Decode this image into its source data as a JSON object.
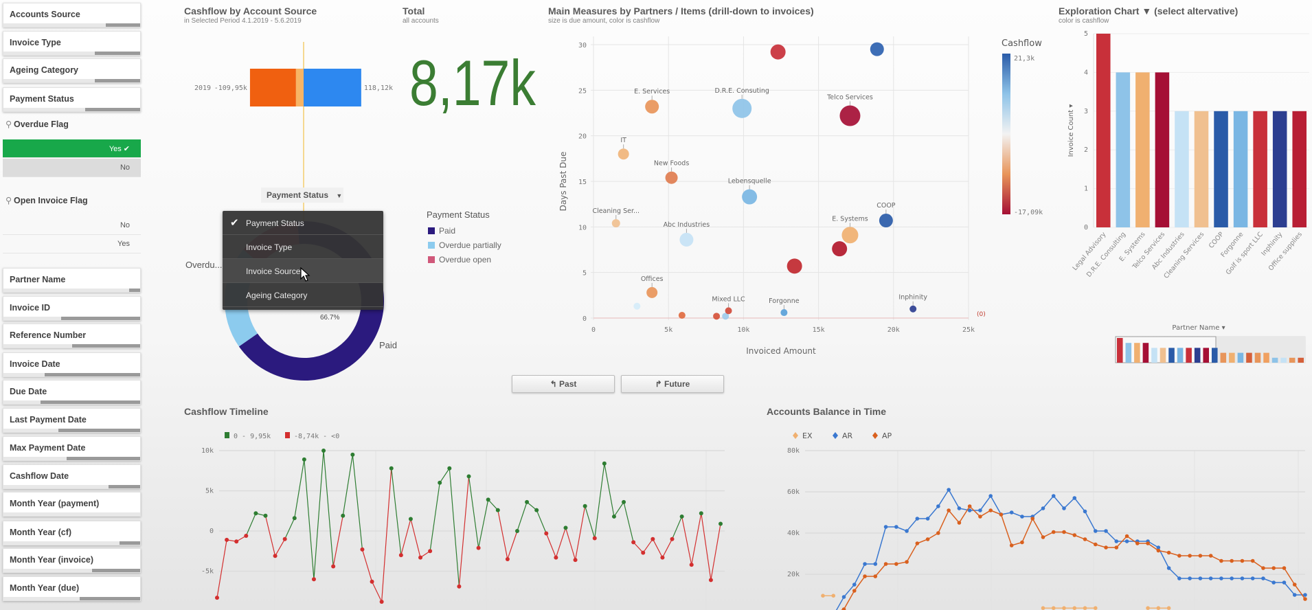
{
  "sidebar": {
    "filters_top": [
      {
        "label": "Accounts Source",
        "excluded": 0.25
      },
      {
        "label": "Invoice Type",
        "excluded": 0.33
      },
      {
        "label": "Ageing Category",
        "excluded": 0.33
      },
      {
        "label": "Payment Status",
        "excluded": 0.4
      }
    ],
    "overdue_flag": {
      "label": "Overdue Flag",
      "icon": "search-icon",
      "values": [
        {
          "label": "Yes",
          "selected": true
        },
        {
          "label": "No",
          "selected": false
        }
      ]
    },
    "open_invoice_flag": {
      "label": "Open Invoice Flag",
      "icon": "search-icon",
      "values": [
        {
          "label": "No",
          "selected": false
        },
        {
          "label": "Yes",
          "selected": false
        }
      ]
    },
    "filters_bottom": [
      {
        "label": "Partner Name",
        "excluded": 0.08
      },
      {
        "label": "Invoice ID",
        "excluded": 0.58
      },
      {
        "label": "Reference Number",
        "excluded": 0.5
      },
      {
        "label": "Invoice Date",
        "excluded": 0.7
      },
      {
        "label": "Due Date",
        "excluded": 0.73
      },
      {
        "label": "Last Payment Date",
        "excluded": 0.6
      },
      {
        "label": "Max Payment Date",
        "excluded": 0.54
      },
      {
        "label": "Cashflow Date",
        "excluded": 0.23
      },
      {
        "label": "Month Year (payment)",
        "excluded": 0
      },
      {
        "label": "Month Year (cf)",
        "excluded": 0.15
      },
      {
        "label": "Month Year (invoice)",
        "excluded": 0.35
      },
      {
        "label": "Month Year (due)",
        "excluded": 0.44
      }
    ]
  },
  "cashflow_source": {
    "title": "Cashflow by Account Source",
    "subtitle": "in Selected Period 4.1.2019 - 5.6.2019",
    "row_label": "2019",
    "neg_label": "-109,95k",
    "pos_label": "118,12k",
    "segments": [
      {
        "value": -15.75,
        "color": "#f7b465"
      },
      {
        "value": -94.2,
        "color": "#f06010"
      },
      {
        "value": 118.12,
        "color": "#2d88f0"
      }
    ],
    "ref_line_color": "#f5d890"
  },
  "total": {
    "title": "Total",
    "subtitle": "all accounts",
    "value": "8,17k",
    "color": "#3b7d33"
  },
  "payment_donut": {
    "dimension_button": "Payment Status",
    "menu": [
      {
        "label": "Payment Status",
        "checked": true
      },
      {
        "label": "Invoice Type",
        "checked": false
      },
      {
        "label": "Invoice Source",
        "checked": false,
        "hover": true
      },
      {
        "label": "Ageing Category",
        "checked": false
      }
    ],
    "legend_title": "Payment Status",
    "slices": [
      {
        "label": "Paid",
        "percent": 66.7,
        "color": "#2b1a7e"
      },
      {
        "label": "Overdue partially",
        "percent": 20.8,
        "color": "#8ccbee"
      },
      {
        "label": "Overdue open",
        "percent": 12.5,
        "color": "#d0587a"
      }
    ],
    "pct_label": "66.7%",
    "outer_label_paid": "Paid",
    "outer_label_overdue": "Overdu..."
  },
  "scatter": {
    "title": "Main Measures by Partners / Items (drill-down to invoices)",
    "subtitle": "size is due amount, color is cashflow",
    "legend_title": "Cashflow",
    "legend_max": "21,3k",
    "legend_min": "-17,09k",
    "null_label": "(0)"
  },
  "exploration": {
    "title": "Exploration Chart ▼ (select altervative)",
    "subtitle": "color is cashflow",
    "y_title": "Invoice Count ▾",
    "x_selector": "Partner Name ▾",
    "mini_bars": [
      {
        "v": 5,
        "c": "#c8303a"
      },
      {
        "v": 4,
        "c": "#8ec3e8"
      },
      {
        "v": 4,
        "c": "#f0b070"
      },
      {
        "v": 4,
        "c": "#a50f35"
      },
      {
        "v": 3,
        "c": "#c5e2f5"
      },
      {
        "v": 3,
        "c": "#f0c090"
      },
      {
        "v": 3,
        "c": "#2a5ba8"
      },
      {
        "v": 3,
        "c": "#7ab6e3"
      },
      {
        "v": 3,
        "c": "#c8303a"
      },
      {
        "v": 3,
        "c": "#2c3e90"
      },
      {
        "v": 3,
        "c": "#a50f35"
      },
      {
        "v": 3,
        "c": "#2a5ba8"
      },
      {
        "v": 2,
        "c": "#e8955a"
      },
      {
        "v": 2,
        "c": "#f0b070"
      },
      {
        "v": 2,
        "c": "#7ab6e3"
      },
      {
        "v": 2,
        "c": "#d5603a"
      },
      {
        "v": 2,
        "c": "#e8955a"
      },
      {
        "v": 2,
        "c": "#f0a060"
      },
      {
        "v": 1,
        "c": "#8ec3e8"
      },
      {
        "v": 1,
        "c": "#c5e2f5"
      },
      {
        "v": 1,
        "c": "#e8955a"
      },
      {
        "v": 1,
        "c": "#d5603a"
      }
    ]
  },
  "nav": {
    "past": "Past",
    "future": "Future"
  },
  "timeline": {
    "title": "Cashflow Timeline",
    "legend": [
      {
        "label": "0 - 9,95k",
        "color": "#2e7d32"
      },
      {
        "label": "-8,74k - <0",
        "color": "#d32f2f"
      }
    ]
  },
  "balance": {
    "title": "Accounts Balance in Time"
  },
  "chart_data": [
    {
      "type": "scatter",
      "title": "Main Measures by Partners / Items (drill-down to invoices)",
      "xlabel": "Invoiced Amount",
      "ylabel": "Days Past Due",
      "xlim": [
        0,
        25000
      ],
      "ylim": [
        0,
        30
      ],
      "xticks": [
        "0",
        "5k",
        "10k",
        "15k",
        "20k",
        "25k"
      ],
      "yticks": [
        "0",
        "5",
        "10",
        "15",
        "20",
        "25",
        "30"
      ],
      "grid": true,
      "points": [
        {
          "label": "",
          "x": 12300,
          "y": 29.2,
          "size": 11,
          "color": "#c8303a"
        },
        {
          "label": "",
          "x": 18900,
          "y": 29.5,
          "size": 10,
          "color": "#2e62b0"
        },
        {
          "label": "E. Services",
          "x": 3900,
          "y": 23.2,
          "size": 10,
          "color": "#e8955a"
        },
        {
          "label": "D.R.E. Consuting",
          "x": 9900,
          "y": 23.0,
          "size": 14,
          "color": "#8ec3e8"
        },
        {
          "label": "Telco Services",
          "x": 17100,
          "y": 22.2,
          "size": 15,
          "color": "#a50f35"
        },
        {
          "label": "IT",
          "x": 2000,
          "y": 18.0,
          "size": 8,
          "color": "#f0b47a"
        },
        {
          "label": "New Foods",
          "x": 5200,
          "y": 15.4,
          "size": 9,
          "color": "#e07d50"
        },
        {
          "label": "Lebensquelle",
          "x": 10400,
          "y": 13.3,
          "size": 11,
          "color": "#7ab6e3"
        },
        {
          "label": "Cleaning Ser...",
          "x": 1500,
          "y": 10.4,
          "size": 6,
          "color": "#f0c090"
        },
        {
          "label": "COOP",
          "x": 19500,
          "y": 10.7,
          "size": 10,
          "color": "#2a5ba8"
        },
        {
          "label": "E. Systems",
          "x": 17100,
          "y": 9.1,
          "size": 12,
          "color": "#f0b070"
        },
        {
          "label": "Abc Industries",
          "x": 6200,
          "y": 8.6,
          "size": 10,
          "color": "#c5e2f5"
        },
        {
          "label": "",
          "x": 16400,
          "y": 7.6,
          "size": 11,
          "color": "#b2182b"
        },
        {
          "label": "",
          "x": 13400,
          "y": 5.7,
          "size": 11,
          "color": "#c0282f"
        },
        {
          "label": "Offices",
          "x": 3900,
          "y": 2.8,
          "size": 8,
          "color": "#e8955a"
        },
        {
          "label": "",
          "x": 2900,
          "y": 1.3,
          "size": 5,
          "color": "#d5ebf8"
        },
        {
          "label": "",
          "x": 5900,
          "y": 0.3,
          "size": 5,
          "color": "#e06a40"
        },
        {
          "label": "",
          "x": 8200,
          "y": 0.2,
          "size": 5,
          "color": "#d5513a"
        },
        {
          "label": "",
          "x": 8800,
          "y": 0.2,
          "size": 5,
          "color": "#9fcbea"
        },
        {
          "label": "Mixed LLC",
          "x": 9000,
          "y": 0.8,
          "size": 5,
          "color": "#d04a3a"
        },
        {
          "label": "Forgonne",
          "x": 12700,
          "y": 0.6,
          "size": 5,
          "color": "#5a9fd8"
        },
        {
          "label": "Inphinity",
          "x": 21300,
          "y": 1.0,
          "size": 5,
          "color": "#2c3e90"
        }
      ],
      "color_scale": {
        "min": -17090,
        "max": 21300,
        "colors": [
          "#a50f35",
          "#e8955a",
          "#f2f2f2",
          "#8ec3e8",
          "#2a5ba8"
        ]
      }
    },
    {
      "type": "bar",
      "title": "Exploration Chart ▼ (select altervative)",
      "ylabel": "Invoice Count",
      "xlabel": "Partner Name",
      "ylim": [
        0,
        5
      ],
      "yticks": [
        "0",
        "1",
        "2",
        "3",
        "4",
        "5"
      ],
      "categories": [
        "Legal Advisory",
        "D.R.E. Consulting",
        "E. Systems",
        "Telco Services",
        "Abc Industries",
        "Cleaning Services",
        "COOP",
        "Forgonne",
        "Golf is sport LLC",
        "Inphinity",
        "Office supplies"
      ],
      "values": [
        5,
        4,
        4,
        4,
        3,
        3,
        3,
        3,
        3,
        3,
        3
      ],
      "colors": [
        "#c8303a",
        "#8ec3e8",
        "#f0b070",
        "#a50f35",
        "#c5e2f5",
        "#f0c090",
        "#2a5ba8",
        "#7ab6e3",
        "#c8303a",
        "#2c3e90",
        "#b81e34"
      ]
    },
    {
      "type": "line",
      "title": "Cashflow Timeline",
      "ylim": [
        -10000,
        10000
      ],
      "yticks": [
        {
          "v": 10000,
          "t": "10k"
        },
        {
          "v": 5000,
          "t": "5k"
        },
        {
          "v": 0,
          "t": "0"
        },
        {
          "v": -5000,
          "t": "-5k"
        }
      ],
      "series": [
        {
          "values": [
            -8300,
            -1100,
            -1300,
            -600,
            2200,
            1900,
            -3100,
            -1000,
            1600,
            8900,
            -6000,
            10000,
            -4400,
            1900,
            9500,
            -2300,
            -6300,
            -8800,
            7800,
            -3000,
            1500,
            -3300,
            -2500,
            6000,
            7800,
            -6900,
            6800,
            -2100,
            3900,
            2600,
            -3500,
            0,
            3600,
            2600,
            -300,
            -3300,
            400,
            -3600,
            3100,
            -900,
            8400,
            1800,
            3600,
            -1400,
            -2700,
            -1000,
            -3300,
            -1000,
            1800,
            -4200,
            2200,
            -6100,
            900
          ]
        }
      ]
    },
    {
      "type": "line",
      "title": "Accounts Balance in Time",
      "ylim": [
        0,
        80000
      ],
      "yticks": [
        {
          "v": 80000,
          "t": "80k"
        },
        {
          "v": 60000,
          "t": "60k"
        },
        {
          "v": 40000,
          "t": "40k"
        },
        {
          "v": 20000,
          "t": "20k"
        }
      ],
      "series": [
        {
          "name": "EX",
          "color": "#f0b070",
          "values": [
            9.6,
            9.6,
            null,
            null,
            null,
            null,
            null,
            null,
            null,
            null,
            null,
            null,
            null,
            null,
            null,
            null,
            null,
            null,
            null,
            null,
            null,
            3.6,
            3.6,
            3.6,
            3.6,
            3.6,
            3.6,
            null,
            null,
            null,
            null,
            3.6,
            3.6,
            3.6,
            null,
            null,
            null,
            null,
            null,
            null,
            null,
            null,
            null,
            null,
            null,
            null,
            null
          ]
        },
        {
          "name": "AR",
          "color": "#3a78d0",
          "values": [
            null,
            0,
            9,
            15,
            25,
            25,
            43,
            43,
            41,
            47,
            47,
            53,
            61,
            52,
            51,
            51,
            58,
            49,
            50,
            48,
            48,
            52,
            58,
            52,
            57,
            50.5,
            41,
            41,
            36,
            36,
            36,
            36,
            33,
            23,
            18,
            18,
            18,
            18,
            18,
            18,
            18,
            18,
            18,
            16,
            16,
            10,
            10
          ]
        },
        {
          "name": "AP",
          "color": "#d9601e",
          "values": [
            null,
            1,
            3,
            12,
            19,
            19,
            25,
            25,
            26,
            35,
            37,
            40,
            51,
            45,
            53,
            48,
            51,
            49,
            34,
            35.5,
            47,
            38,
            40.5,
            40.5,
            39,
            37,
            34.5,
            33,
            33,
            38.5,
            35,
            35,
            31.5,
            30.5,
            29,
            29,
            29,
            29,
            26.5,
            26.5,
            26.5,
            26.5,
            23,
            23,
            23,
            15,
            8
          ]
        }
      ],
      "value_unit": "k"
    }
  ]
}
